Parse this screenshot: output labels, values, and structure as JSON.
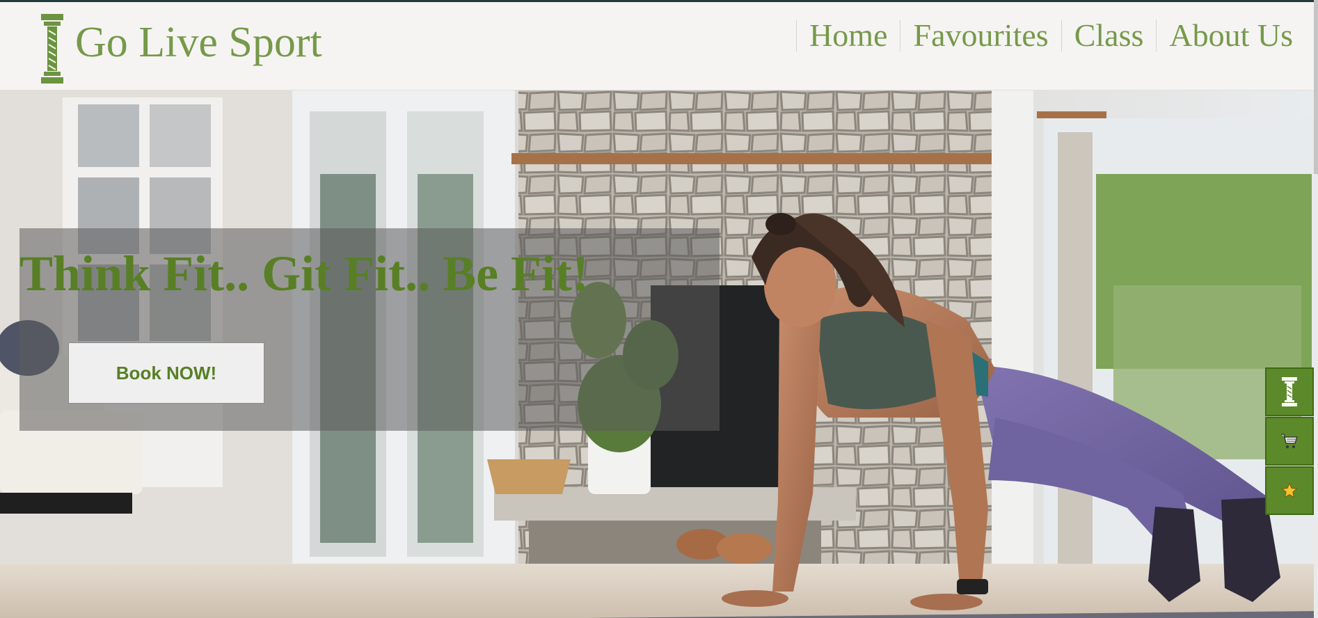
{
  "site": {
    "brand": "Go Live Sport",
    "logo_icon": "dumbbell-icon"
  },
  "nav": {
    "items": [
      {
        "label": "Home"
      },
      {
        "label": "Favourites"
      },
      {
        "label": "Class"
      },
      {
        "label": "About Us"
      }
    ]
  },
  "hero": {
    "heading": "Think Fit.. Git Fit.. Be Fit!",
    "cta_label": "Book NOW!",
    "image": "woman-doing-plank-in-living-room-photo"
  },
  "dock": {
    "items": [
      {
        "icon": "dumbbell-icon"
      },
      {
        "icon": "cart-icon"
      },
      {
        "icon": "star-icon"
      }
    ]
  },
  "colors": {
    "brand_green": "#76994a",
    "heading_green": "#587f25",
    "dock_green": "#5c8a2b",
    "header_bg": "#f5f4f2"
  }
}
